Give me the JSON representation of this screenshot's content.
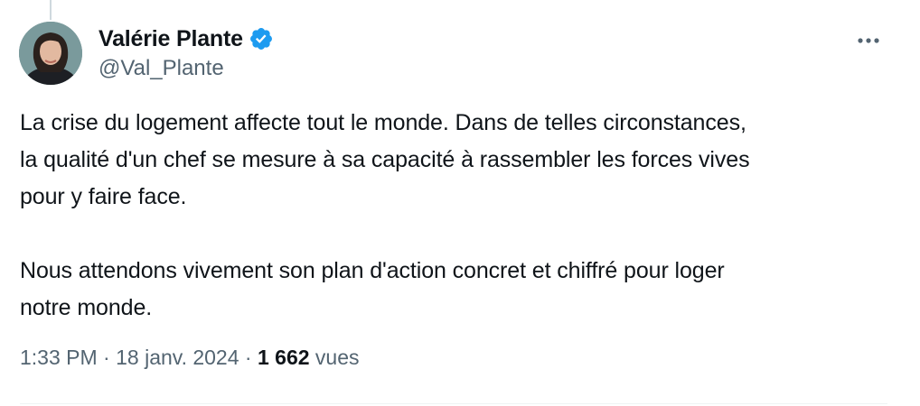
{
  "author": {
    "display_name": "Valérie Plante",
    "handle": "@Val_Plante",
    "verified": true,
    "verified_color": "#1d9bf0"
  },
  "tweet": {
    "paragraphs": [
      "La crise du logement affecte tout le monde. Dans de telles circonstances,\nla qualité d'un chef se mesure à sa capacité à rassembler les forces vives\npour y faire face.",
      "Nous attendons vivement son plan d'action concret et chiffré pour loger\nnotre monde."
    ]
  },
  "meta": {
    "time": "1:33 PM",
    "separator": "·",
    "date": "18 janv. 2024",
    "views_count": "1 662",
    "views_label": "vues"
  },
  "icons": {
    "more": "more-icon",
    "verified": "verified-badge-icon"
  },
  "colors": {
    "text_primary": "#0f1419",
    "text_secondary": "#536471",
    "accent": "#1d9bf0",
    "divider": "#eff3f4"
  }
}
